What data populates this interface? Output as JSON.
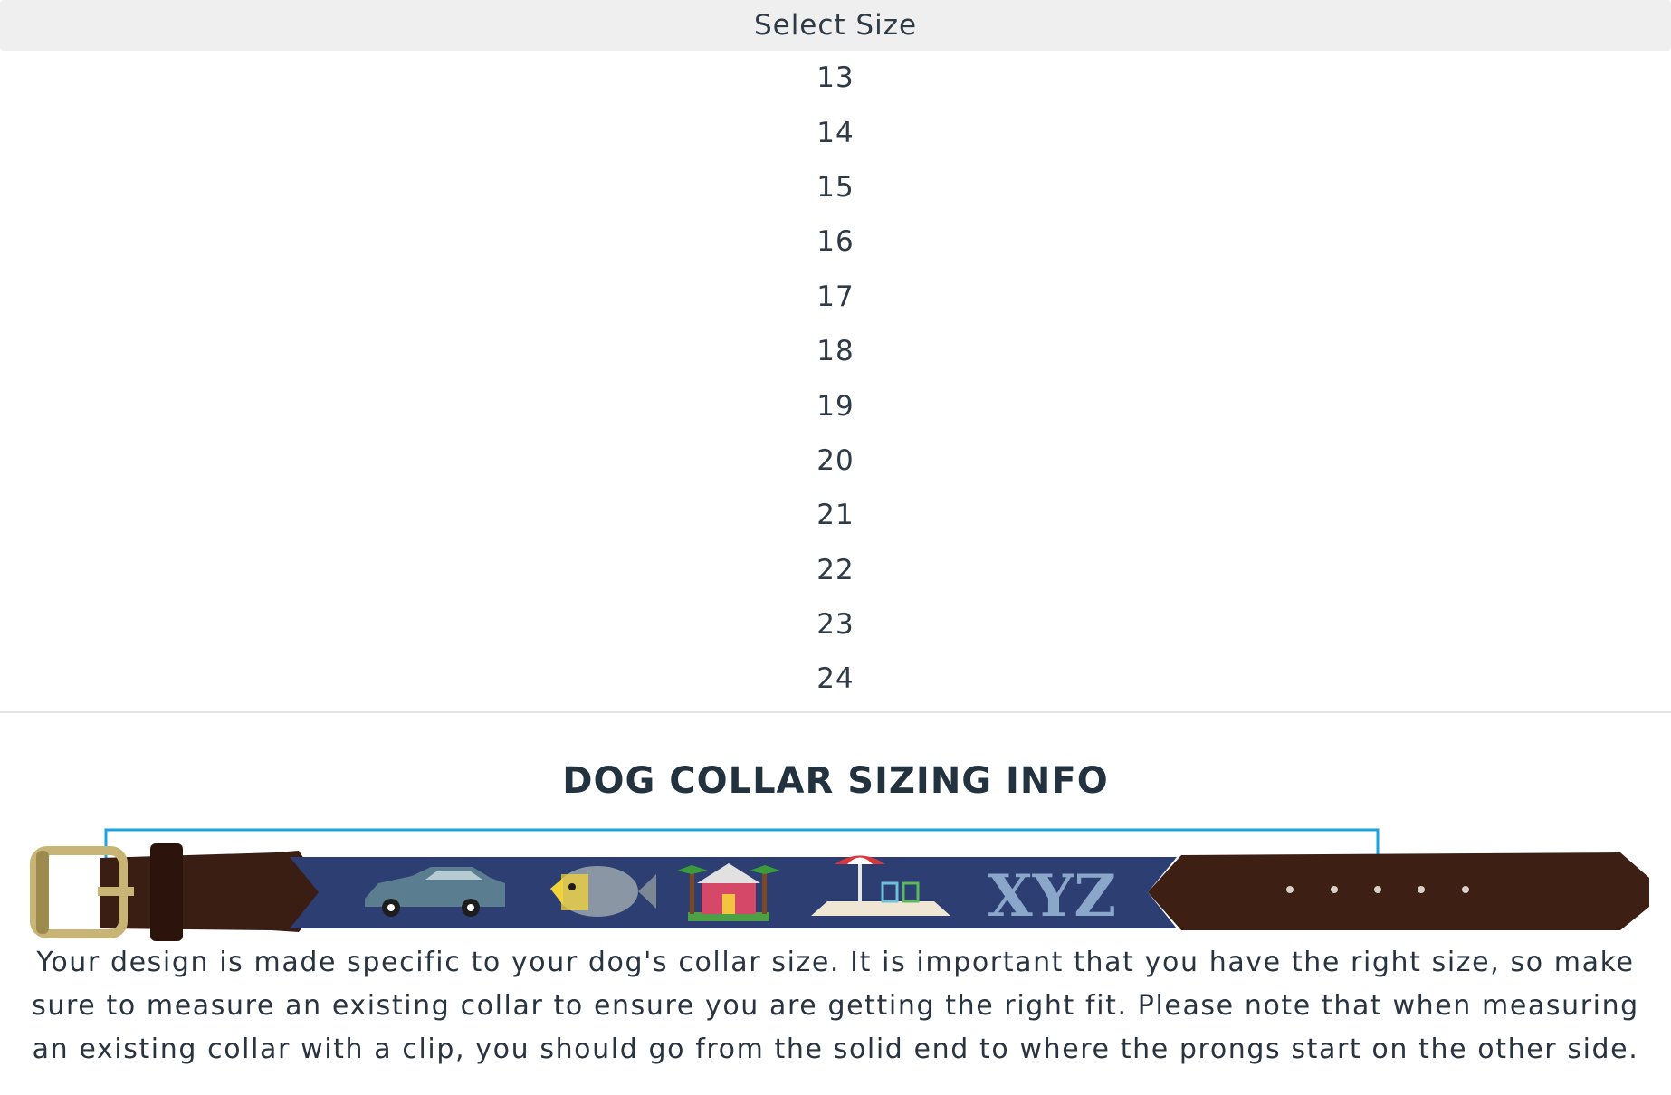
{
  "size_select": {
    "label": "Select Size",
    "options": [
      "13",
      "14",
      "15",
      "16",
      "17",
      "18",
      "19",
      "20",
      "21",
      "22",
      "23",
      "24"
    ]
  },
  "sizing_info": {
    "title": "DOG COLLAR SIZING INFO",
    "collar_text": "XYZ",
    "description": "Your design is made specific to your dog's collar size. It is important that you have the right size, so make sure to measure an existing collar to ensure you are getting the right fit. Please note that when measuring an existing collar with a clip, you should go from the solid end to where the prongs start on the other side."
  },
  "colors": {
    "header_bg": "#efefef",
    "measure_line": "#19a6e0",
    "collar_navy": "#2d3e72",
    "leather_brown": "#3e1f14",
    "buckle_brass": "#c8b575"
  },
  "icons": [
    "buckle-icon",
    "car-icon",
    "fish-icon",
    "house-icon",
    "beach-umbrella-icon"
  ]
}
